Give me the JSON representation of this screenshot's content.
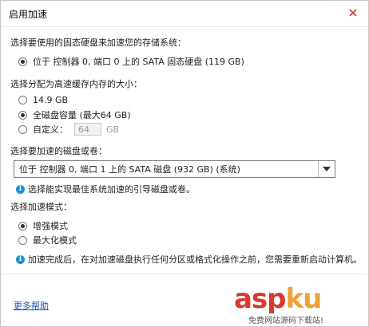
{
  "window": {
    "title": "启用加速"
  },
  "section_storage": {
    "label": "选择要使用的固态硬盘来加速您的存储系统：",
    "option": "位于 控制器 0, 端口 0 上的 SATA 固态硬盘 (119 GB)"
  },
  "section_cache": {
    "label": "选择分配为高速缓存内存的大小：",
    "options": [
      {
        "label": "14.9 GB",
        "selected": false
      },
      {
        "label": "全磁盘容量 (最大64 GB)",
        "selected": true
      },
      {
        "label": "自定义：",
        "selected": false
      }
    ],
    "custom_value": "64",
    "custom_unit": "GB"
  },
  "section_disk": {
    "label": "选择要加速的磁盘或卷：",
    "selected": "位于 控制器 0, 端口 1 上的 SATA 磁盘 (932 GB) (系统)",
    "hint": "选择能实现最佳系统加速的引导磁盘或卷。"
  },
  "section_mode": {
    "label": "选择加速模式：",
    "options": [
      {
        "label": "增强模式",
        "selected": true
      },
      {
        "label": "最大化模式",
        "selected": false
      }
    ],
    "note": "加速完成后，在对加速磁盘执行任何分区或格式化操作之前，您需要重新启动计算机。"
  },
  "footer": {
    "help_link": "更多帮助"
  },
  "watermark": {
    "brand_a": "asp",
    "brand_b": "ku",
    "tagline": "免费网站源码下载站!"
  },
  "colors": {
    "info_blue": "#1a8fd6",
    "link_blue": "#1a4fb5",
    "watermark_red": "#d63b2f",
    "watermark_orange": "#f0a236"
  }
}
